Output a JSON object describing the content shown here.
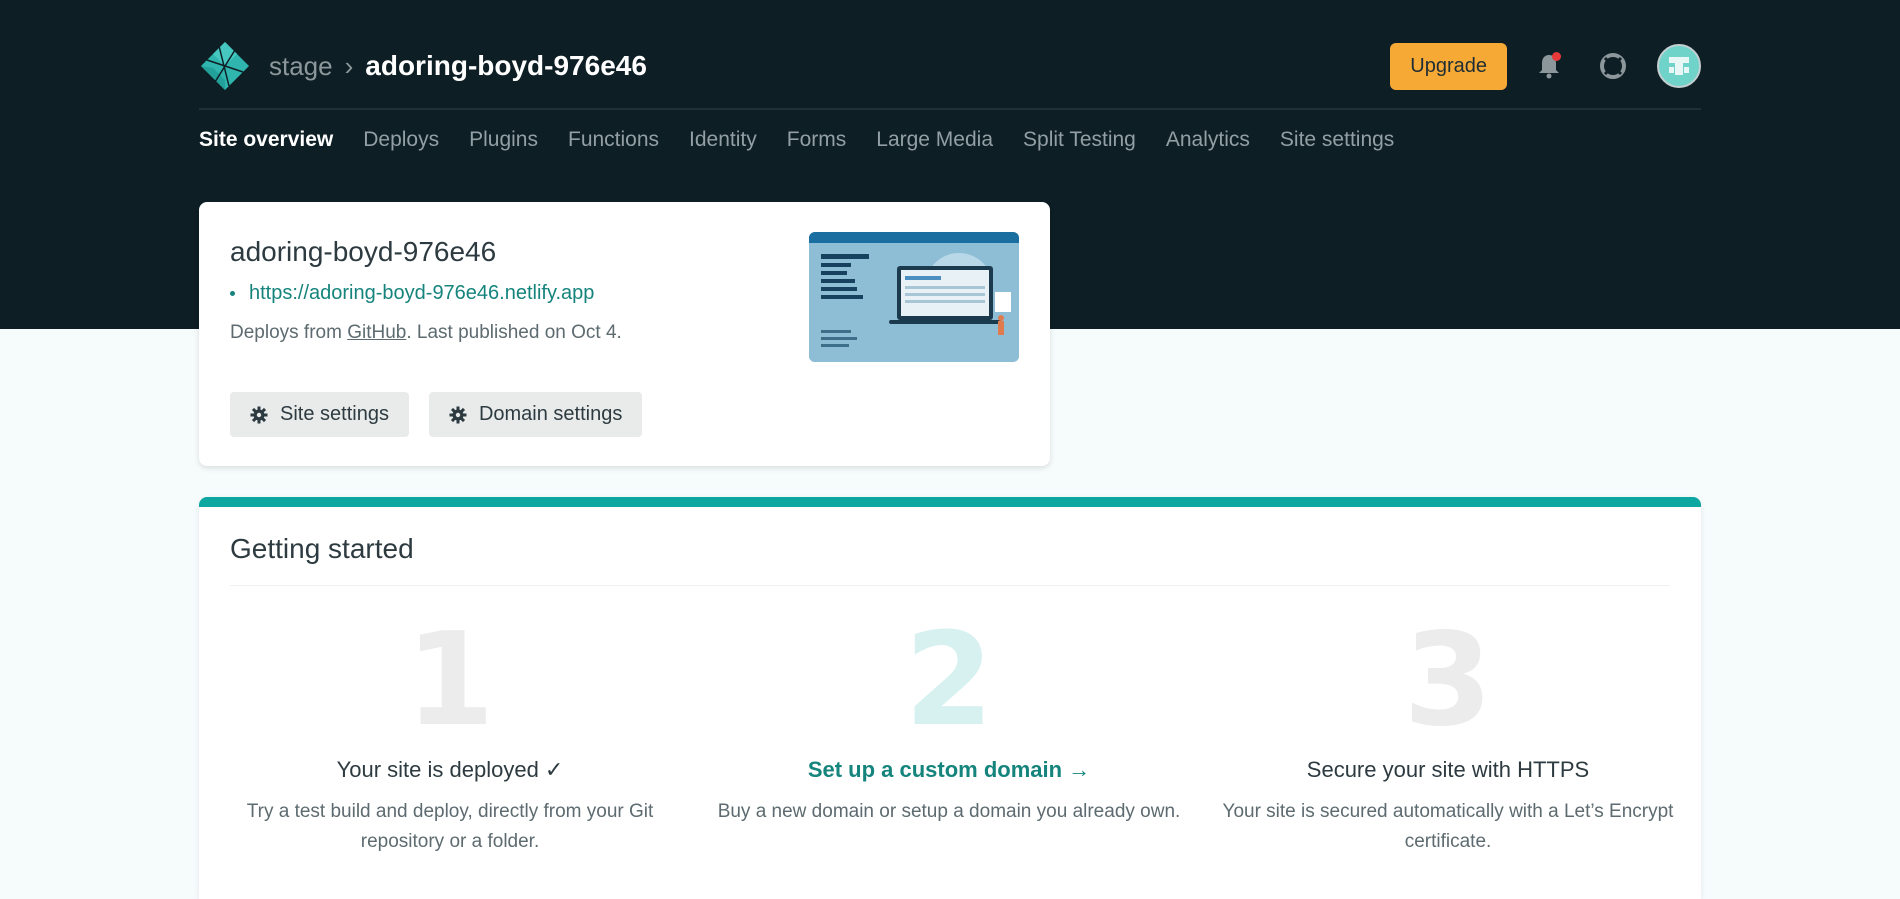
{
  "header": {
    "team": "stage",
    "separator": "›",
    "site": "adoring-boyd-976e46",
    "upgrade_label": "Upgrade"
  },
  "nav": {
    "items": [
      "Site overview",
      "Deploys",
      "Plugins",
      "Functions",
      "Identity",
      "Forms",
      "Large Media",
      "Split Testing",
      "Analytics",
      "Site settings"
    ],
    "active": "Site overview"
  },
  "site_card": {
    "name": "adoring-boyd-976e46",
    "url": "https://adoring-boyd-976e46.netlify.app",
    "deploy_prefix": "Deploys from ",
    "deploy_source": "GitHub",
    "deploy_suffix": ". Last published on Oct 4.",
    "site_settings_label": "Site settings",
    "domain_settings_label": "Domain settings"
  },
  "getting_started": {
    "title": "Getting started",
    "steps": [
      {
        "number": "1",
        "title": "Your site is deployed ✓",
        "description": "Try a test build and deploy, directly from your Git repository or a folder."
      },
      {
        "number": "2",
        "title": "Set up a custom domain →",
        "description": "Buy a new domain or setup a domain you already own."
      },
      {
        "number": "3",
        "title": "Secure your site with HTTPS",
        "description": "Your site is secured automatically with a Let’s Encrypt certificate."
      }
    ]
  },
  "colors": {
    "header_bg": "#0e1e25",
    "accent_teal": "#15847d",
    "upgrade_orange": "#f7a935",
    "progress_bar": "#0ba7a0"
  },
  "icons": [
    "netlify-logo-icon",
    "bell-icon",
    "lifebuoy-icon",
    "gear-icon"
  ]
}
